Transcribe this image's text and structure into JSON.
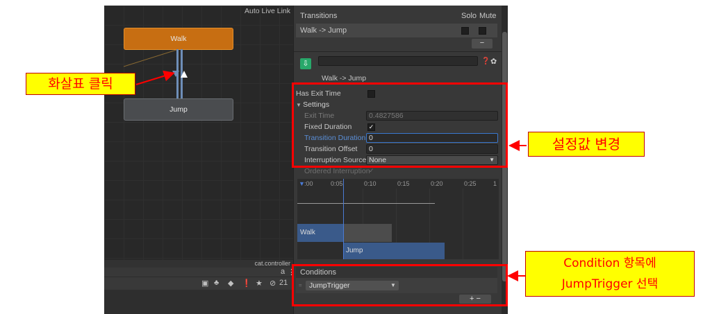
{
  "graph": {
    "auto_live_link": "Auto Live Link",
    "states": {
      "walk": "Walk",
      "jump": "Jump"
    },
    "controller_name": "cat.controller",
    "toolbar": {
      "count": "21"
    }
  },
  "inspector": {
    "transitions_title": "Transitions",
    "solo_label": "Solo",
    "mute_label": "Mute",
    "transition_item": "Walk -> Jump",
    "minus_label": "−",
    "asset_subtitle": "Walk -> Jump",
    "has_exit_time_label": "Has Exit Time",
    "settings_label": "Settings",
    "exit_time_label": "Exit Time",
    "exit_time_value": "0.4827586",
    "fixed_duration_label": "Fixed Duration",
    "transition_duration_label": "Transition Duration (",
    "transition_duration_value": "0",
    "transition_offset_label": "Transition Offset",
    "transition_offset_value": "0",
    "interruption_source_label": "Interruption Source",
    "interruption_source_value": "None",
    "ordered_interruption_label": "Ordered Interruption",
    "timeline": {
      "ticks": [
        ":00",
        "0:05",
        "0:10",
        "0:15",
        "0:20",
        "0:25",
        "1"
      ],
      "walk_label": "Walk",
      "jump_label": "Jump"
    },
    "conditions_title": "Conditions",
    "condition_param": "JumpTrigger",
    "plus_minus": "+  −"
  },
  "annotations": {
    "arrow_click": "화살표 클릭",
    "change_settings": "설정값 변경",
    "condition_line1": "Condition 항목에",
    "condition_line2": "JumpTrigger 선택"
  },
  "colors": {
    "walk_state": "#c76e12",
    "jump_state": "#4a4c4f",
    "annotation_box": "#ff0000",
    "callout_bg": "#ffff00",
    "highlight_label": "#5a8fd8"
  }
}
